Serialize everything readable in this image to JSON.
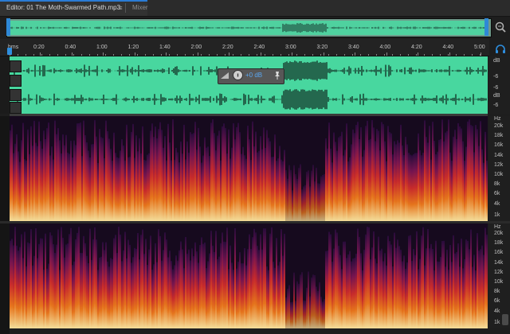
{
  "tabs": {
    "editor_label": "Editor: 01 The Moth-Swarmed Path.mp3",
    "menu_glyph": "≡",
    "mixer_label": "Mixer"
  },
  "ruler": {
    "unit": "hms",
    "labels": [
      "0:20",
      "0:40",
      "1:00",
      "1:20",
      "1:40",
      "2:00",
      "2:20",
      "2:40",
      "3:00",
      "3:20",
      "3:40",
      "4:00",
      "4:20",
      "4:40",
      "5:00"
    ]
  },
  "waveform": {
    "db_labels": [
      "dB",
      "-6",
      "-6",
      "dB",
      "-6"
    ],
    "color": "#48d79f"
  },
  "hud": {
    "value": "+0 dB"
  },
  "spectral": {
    "hz_unit": "Hz",
    "channel1_labels": [
      "20k",
      "18k",
      "16k",
      "14k",
      "12k",
      "10k",
      "8k",
      "6k",
      "4k",
      "1k"
    ],
    "channel2_labels": [
      "20k",
      "18k",
      "16k",
      "14k",
      "12k",
      "10k",
      "8k",
      "6k",
      "4k",
      "1k"
    ]
  },
  "icons": {
    "zoom": "zoom-icon",
    "headphones": "headphones-icon",
    "volume": "volume-icon",
    "pin": "pin-icon"
  },
  "colors": {
    "accent": "#2e8fe0",
    "waveform": "#48d79f",
    "overview": "#4fd19f"
  }
}
